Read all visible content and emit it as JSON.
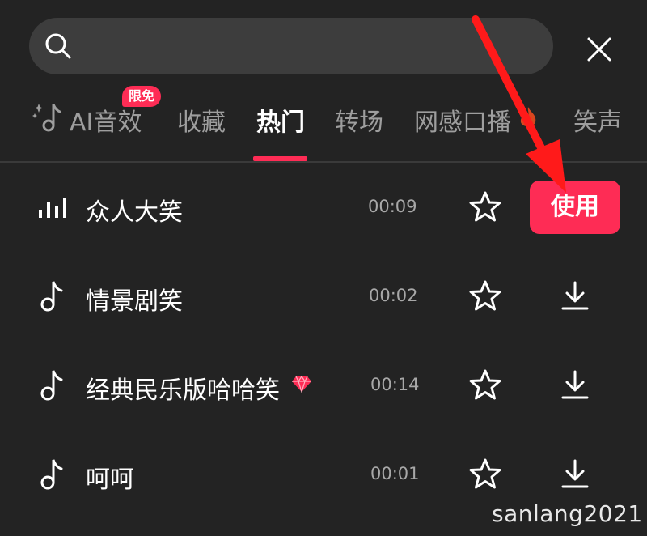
{
  "search": {
    "placeholder": ""
  },
  "tabs": [
    {
      "label": "AI音效",
      "badge": "限免"
    },
    {
      "label": "收藏"
    },
    {
      "label": "热门"
    },
    {
      "label": "转场"
    },
    {
      "label": "网感口播"
    },
    {
      "label": "笑声"
    }
  ],
  "active_tab": "热门",
  "rows": [
    {
      "title": "众人大笑",
      "duration": "00:09",
      "icon": "waveform-icon",
      "action": "使用"
    },
    {
      "title": "情景剧笑",
      "duration": "00:02",
      "icon": "music-note-icon",
      "action": "download"
    },
    {
      "title": "经典民乐版哈哈笑",
      "duration": "00:14",
      "icon": "music-note-icon",
      "action": "download",
      "gem": true
    },
    {
      "title": "呵呵",
      "duration": "00:01",
      "icon": "music-note-icon",
      "action": "download"
    }
  ],
  "watermark": "sanlang2021",
  "colors": {
    "background": "#232323",
    "accent": "#fe2c55",
    "search_bg": "#3d3d3d",
    "arrow": "#ff1a1a"
  }
}
